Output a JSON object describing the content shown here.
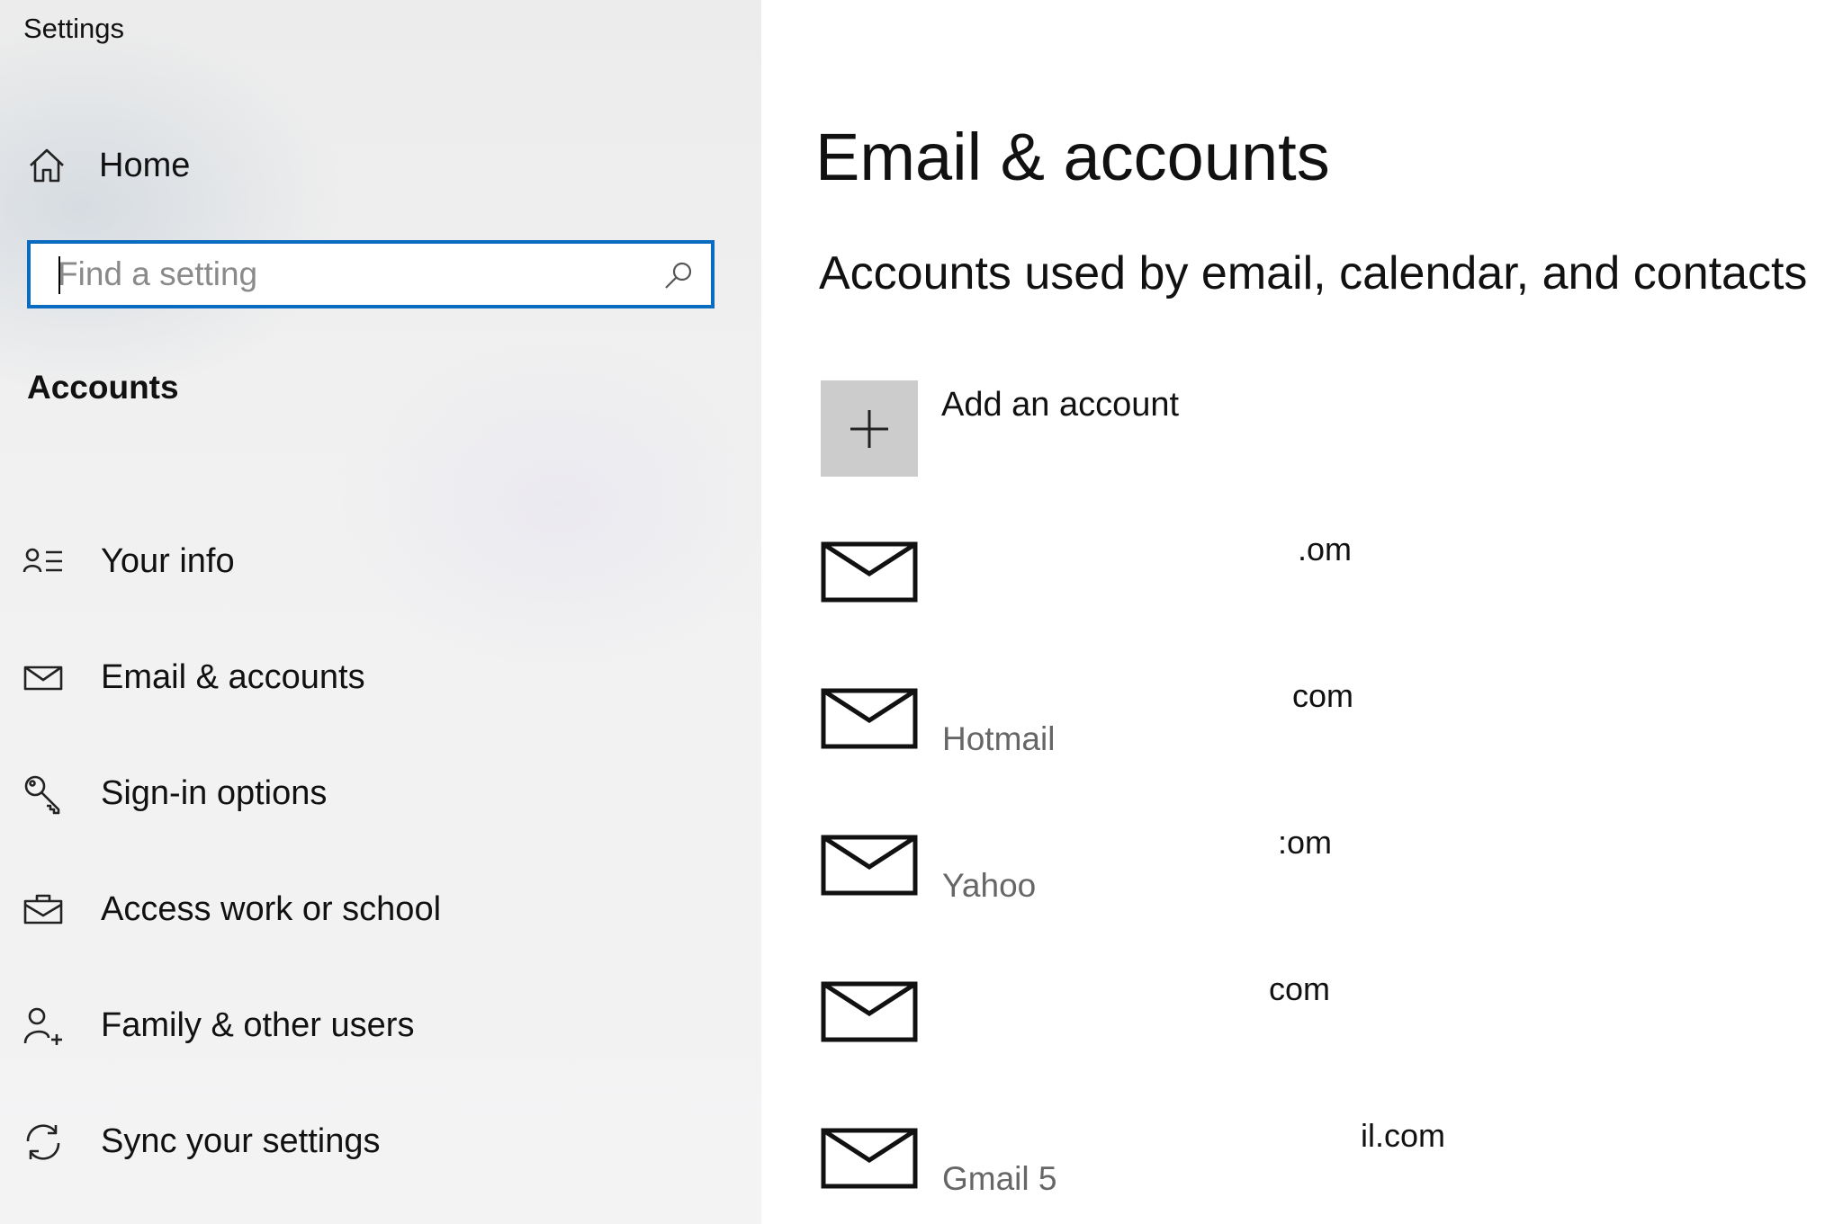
{
  "window": {
    "title": "Settings"
  },
  "sidebar": {
    "home_label": "Home",
    "search": {
      "placeholder": "Find a setting",
      "value": ""
    },
    "section_title": "Accounts",
    "items": [
      {
        "label": "Your info",
        "icon": "person-list-icon"
      },
      {
        "label": "Email & accounts",
        "icon": "mail-icon"
      },
      {
        "label": "Sign-in options",
        "icon": "key-icon"
      },
      {
        "label": "Access work or school",
        "icon": "briefcase-icon"
      },
      {
        "label": "Family & other users",
        "icon": "person-add-icon"
      },
      {
        "label": "Sync your settings",
        "icon": "sync-icon"
      }
    ]
  },
  "main": {
    "title": "Email & accounts",
    "subheading": "Accounts used by email, calendar, and contacts",
    "add_account_label": "Add an account",
    "accounts": [
      {
        "email": ".om",
        "provider": ""
      },
      {
        "email": "com",
        "provider": "Hotmail"
      },
      {
        "email": ":om",
        "provider": "Yahoo"
      },
      {
        "email": "com",
        "provider": ""
      },
      {
        "email": "il.com",
        "provider": "Gmail 5"
      }
    ]
  },
  "colors": {
    "accent": "#0a6cc0",
    "add_tile": "#cccccc",
    "sidebar_bg": "#f0f0f0",
    "secondary_text": "#666666"
  }
}
